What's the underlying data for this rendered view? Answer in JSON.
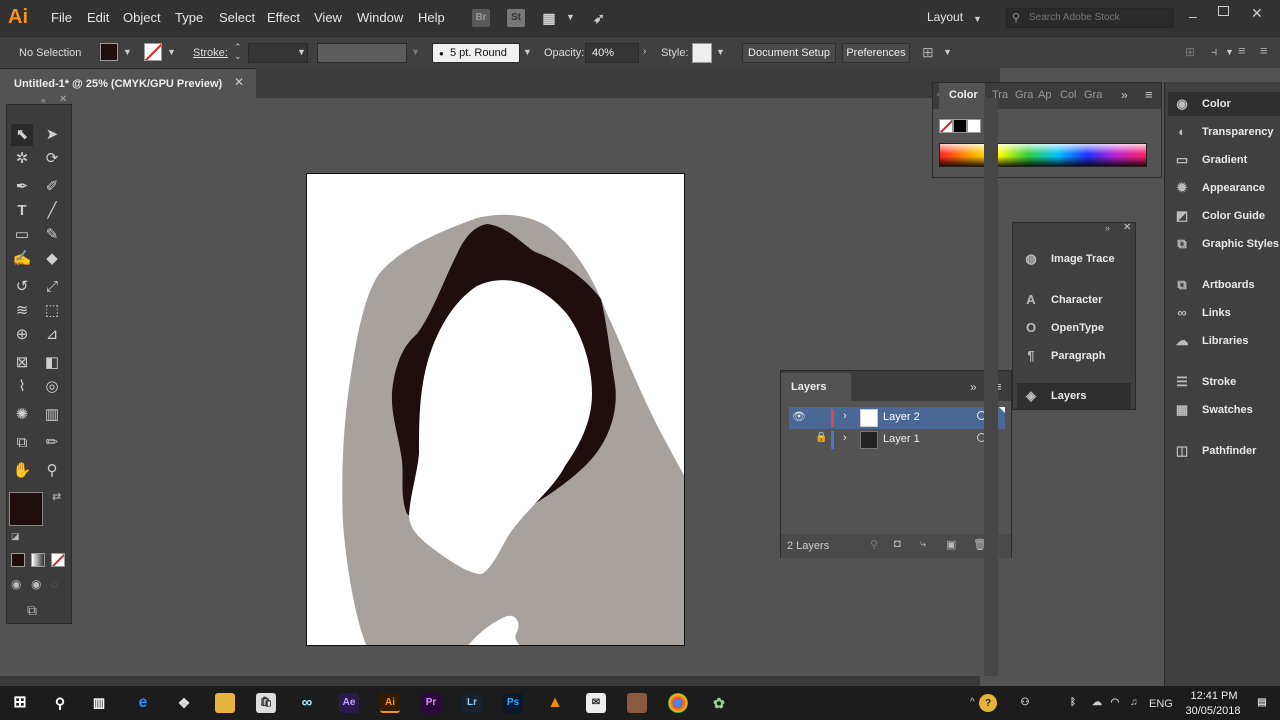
{
  "app": {
    "logo": "Ai",
    "colors": {
      "accent": "#f7921e",
      "fill": "#1e0e0d",
      "silhouette": "#a8a29f",
      "layer2": "#e0484e",
      "layer1": "#5172d4"
    }
  },
  "menubar": {
    "items": [
      "File",
      "Edit",
      "Object",
      "Type",
      "Select",
      "Effect",
      "View",
      "Window",
      "Help"
    ],
    "bridge": "Br",
    "stock": "St",
    "workspace": "Layout",
    "search_placeholder": "Search Adobe Stock"
  },
  "controlbar": {
    "selection": "No Selection",
    "stroke_label": "Stroke:",
    "brush": "5 pt. Round",
    "opacity_label": "Opacity:",
    "opacity_value": "40%",
    "style_label": "Style:",
    "document_setup": "Document Setup",
    "preferences": "Preferences"
  },
  "document": {
    "tab_title": "Untitled-1* @ 25% (CMYK/GPU Preview)"
  },
  "color_panel": {
    "tabs": [
      "Color",
      "Tra",
      "Gra",
      "Ap",
      "Col",
      "Gra"
    ]
  },
  "float_panel": {
    "items": [
      "Image Trace",
      "Character",
      "OpenType",
      "Paragraph",
      "Layers"
    ],
    "icons": [
      "image-trace-icon",
      "character-icon",
      "opentype-icon",
      "paragraph-icon",
      "layers-icon"
    ]
  },
  "layers_panel": {
    "title": "Layers",
    "layers": [
      {
        "name": "Layer 2"
      },
      {
        "name": "Layer 1"
      }
    ],
    "count": "2 Layers"
  },
  "dock": {
    "items": [
      "Color",
      "Transparency",
      "Gradient",
      "Appearance",
      "Color Guide",
      "Graphic Styles",
      "Artboards",
      "Links",
      "Libraries",
      "Stroke",
      "Swatches",
      "Pathfinder"
    ]
  },
  "taskbar": {
    "time": "12:41 PM",
    "date": "30/05/2018",
    "lang": "ENG"
  }
}
